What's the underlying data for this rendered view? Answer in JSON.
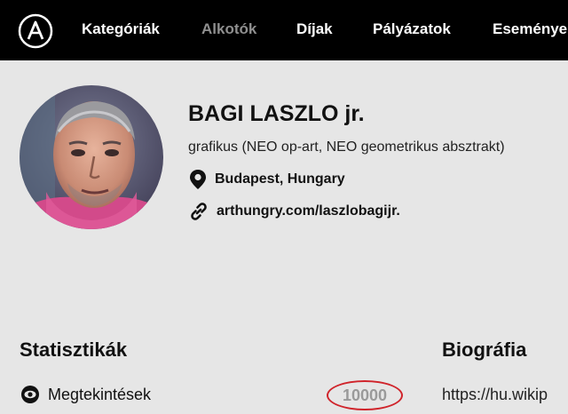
{
  "nav": {
    "items": [
      {
        "label": "Kategóriák",
        "active": true
      },
      {
        "label": "Alkotók",
        "active": false
      },
      {
        "label": "Díjak",
        "active": true
      },
      {
        "label": "Pályázatok",
        "active": true
      },
      {
        "label": "Eseménye",
        "active": true
      }
    ]
  },
  "profile": {
    "name": "BAGI LASZLO jr.",
    "profession": "grafikus (NEO op-art, NEO geometrikus absztrakt)",
    "location": "Budapest, Hungary",
    "website": "arthungry.com/laszlobagijr.",
    "location_icon": "map-pin-icon",
    "website_icon": "link-icon"
  },
  "stats": {
    "title": "Statisztikák",
    "views_label": "Megtekintések",
    "views_value": "10000",
    "views_icon": "eye-icon"
  },
  "bio": {
    "title": "Biográfia",
    "text": "https://hu.wikip"
  },
  "colors": {
    "topbar": "#000000",
    "background": "#e6e6e6",
    "highlight_circle": "#d0242b",
    "muted_nav": "#8f8f8f"
  }
}
